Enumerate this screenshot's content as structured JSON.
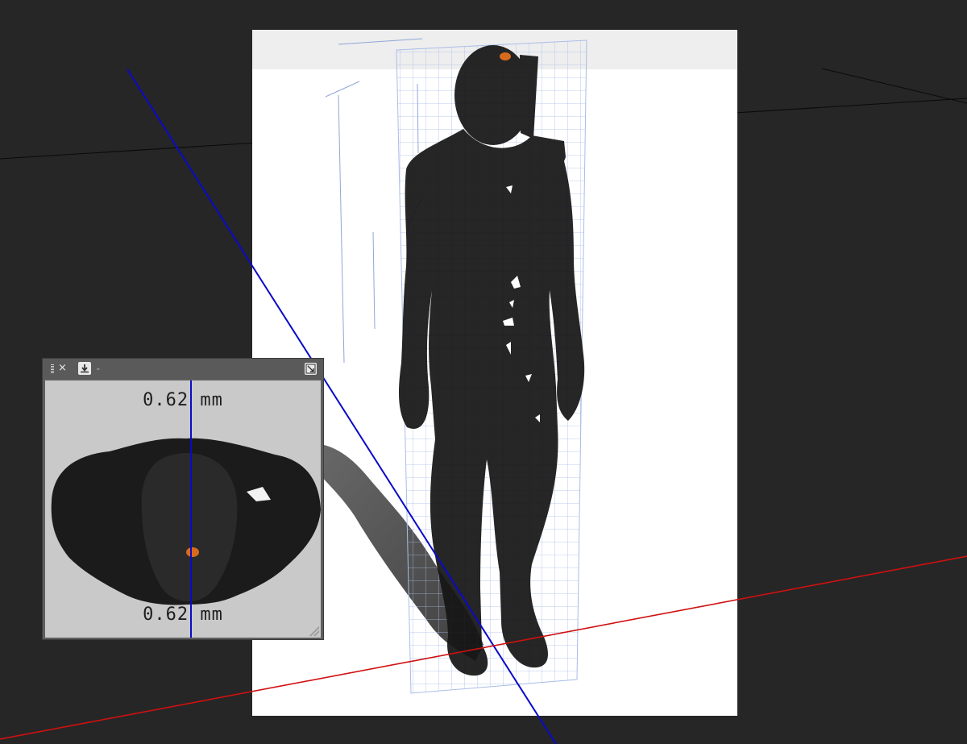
{
  "canvas": {
    "background": "#262626",
    "sheet_color": "#ffffff",
    "model_color": "#161616",
    "axis_colors": {
      "blue": "#0a0ac8",
      "red": "#d01010",
      "black": "#0a0a0a"
    },
    "grid_color": "#a9bde8"
  },
  "panel": {
    "close_glyph": "×",
    "download_icon": "download-icon",
    "dropdown_caret": "⌄",
    "export_icon": "export-icon",
    "measurement_top": "0.62 mm",
    "measurement_bottom": "0.62 mm"
  }
}
